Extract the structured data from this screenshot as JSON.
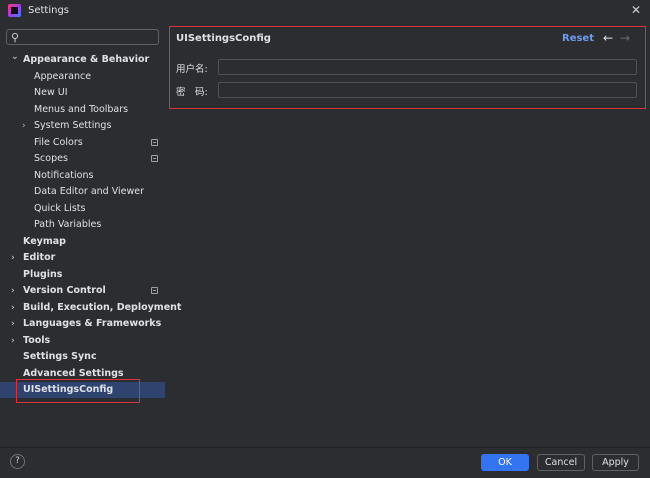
{
  "window": {
    "title": "Settings"
  },
  "search": {
    "placeholder": ""
  },
  "sidebar": {
    "items": [
      {
        "label": "Appearance & Behavior",
        "level": 0,
        "bold": true,
        "expanded": true,
        "chevron": "down"
      },
      {
        "label": "Appearance",
        "level": 1
      },
      {
        "label": "New UI",
        "level": 1
      },
      {
        "label": "Menus and Toolbars",
        "level": 1
      },
      {
        "label": "System Settings",
        "level": 1,
        "chevron": "right"
      },
      {
        "label": "File Colors",
        "level": 1,
        "modified": true
      },
      {
        "label": "Scopes",
        "level": 1,
        "modified": true
      },
      {
        "label": "Notifications",
        "level": 1
      },
      {
        "label": "Data Editor and Viewer",
        "level": 1
      },
      {
        "label": "Quick Lists",
        "level": 1
      },
      {
        "label": "Path Variables",
        "level": 1
      },
      {
        "label": "Keymap",
        "level": 0,
        "bold": true
      },
      {
        "label": "Editor",
        "level": 0,
        "bold": true,
        "chevron": "right"
      },
      {
        "label": "Plugins",
        "level": 0,
        "bold": true
      },
      {
        "label": "Version Control",
        "level": 0,
        "bold": true,
        "chevron": "right",
        "modified": true
      },
      {
        "label": "Build, Execution, Deployment",
        "level": 0,
        "bold": true,
        "chevron": "right"
      },
      {
        "label": "Languages & Frameworks",
        "level": 0,
        "bold": true,
        "chevron": "right"
      },
      {
        "label": "Tools",
        "level": 0,
        "bold": true,
        "chevron": "right"
      },
      {
        "label": "Settings Sync",
        "level": 0,
        "bold": true
      },
      {
        "label": "Advanced Settings",
        "level": 0,
        "bold": true
      },
      {
        "label": "UISettingsConfig",
        "level": 0,
        "bold": true,
        "selected": true
      }
    ]
  },
  "panel": {
    "title": "UISettingsConfig",
    "reset_label": "Reset",
    "back_icon": "←",
    "forward_icon": "→",
    "username_label": "用户名:",
    "username_value": "",
    "password_label": "密　码:",
    "password_value": ""
  },
  "footer": {
    "help_label": "?",
    "ok_label": "OK",
    "cancel_label": "Cancel",
    "apply_label": "Apply"
  },
  "colors": {
    "background": "#2b2d30",
    "selection": "#2e436e",
    "accent": "#3574f0",
    "link": "#6d9bf5",
    "highlight_border": "#d9323c"
  }
}
